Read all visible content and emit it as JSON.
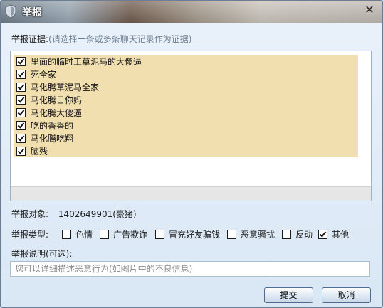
{
  "window": {
    "title": "举报",
    "close_glyph": "✕"
  },
  "evidence": {
    "label": "举报证据:",
    "hint": "(请选择一条或多条聊天记录作为证据)",
    "items": [
      {
        "text": "里面的临时工草泥马的大傻逼",
        "checked": true
      },
      {
        "text": "死全家",
        "checked": true
      },
      {
        "text": "马化腾草泥马全家",
        "checked": true
      },
      {
        "text": "马化腾日你妈",
        "checked": true
      },
      {
        "text": "马化腾大傻逼",
        "checked": true
      },
      {
        "text": "吃的香香的",
        "checked": true
      },
      {
        "text": "马化腾吃翔",
        "checked": true
      },
      {
        "text": "脑残",
        "checked": true
      }
    ]
  },
  "target": {
    "label": "举报对象:",
    "value": "1402649901(豪猪)"
  },
  "types": {
    "label": "举报类型:",
    "options": [
      {
        "text": "色情",
        "checked": false
      },
      {
        "text": "广告欺诈",
        "checked": false
      },
      {
        "text": "冒充好友骗钱",
        "checked": false
      },
      {
        "text": "恶意骚扰",
        "checked": false
      },
      {
        "text": "反动",
        "checked": false
      },
      {
        "text": "其他",
        "checked": true
      }
    ]
  },
  "description": {
    "label": "举报说明(可选):",
    "placeholder": "您可以详细描述恶意行为(如图片中的不良信息)",
    "value": ""
  },
  "buttons": {
    "submit": "提交",
    "cancel": "取消"
  }
}
